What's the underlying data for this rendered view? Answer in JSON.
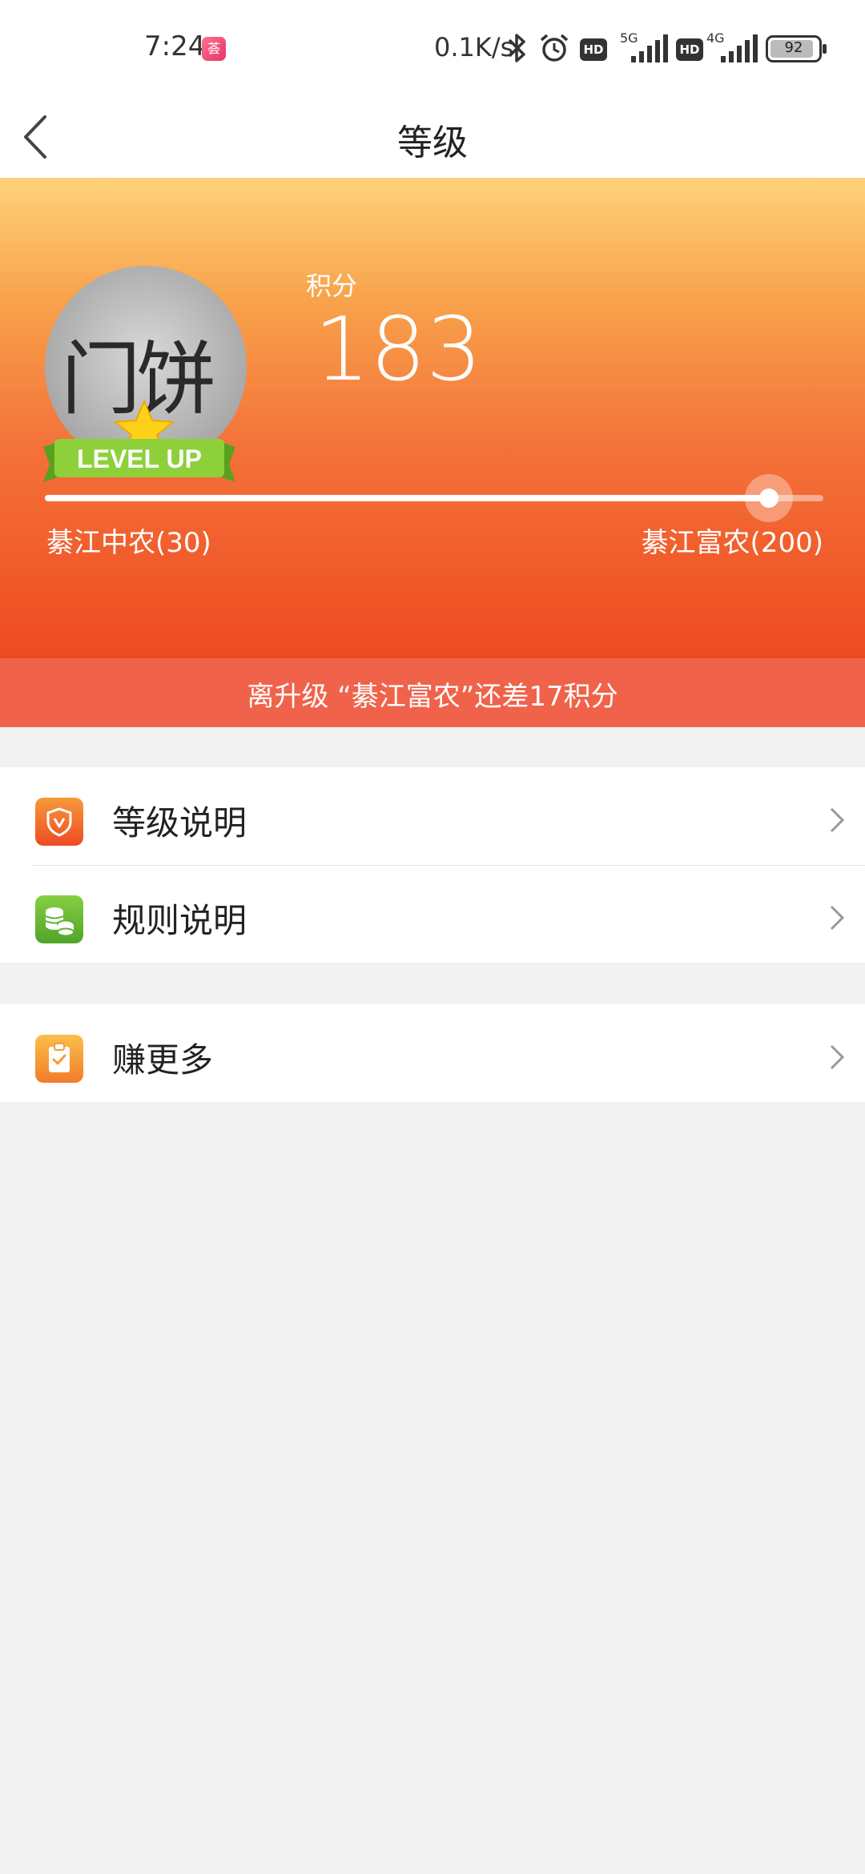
{
  "status_bar": {
    "time": "7:24",
    "app_badge": "荟",
    "net_speed": "0.1K/s",
    "signal1_label": "5G",
    "signal2_label": "4G",
    "hd_label": "HD",
    "battery": "92"
  },
  "nav": {
    "title": "等级"
  },
  "hero": {
    "score_label": "积分",
    "score_value": "183",
    "avatar_text": "门饼",
    "badge_text": "LEVEL UP",
    "current_level": "綦江中农(30)",
    "next_level": "綦江富农(200)",
    "progress": 0.93
  },
  "banner": {
    "text": "离升级 “綦江富农”还差17积分"
  },
  "menu": {
    "items": [
      {
        "label": "等级说明",
        "icon": "shield-icon",
        "color": "#f2613a"
      },
      {
        "label": "规则说明",
        "icon": "coins-icon",
        "color": "#6cbf3a"
      },
      {
        "label": "赚更多",
        "icon": "clipboard-check-icon",
        "color": "#f6a03c"
      }
    ]
  }
}
